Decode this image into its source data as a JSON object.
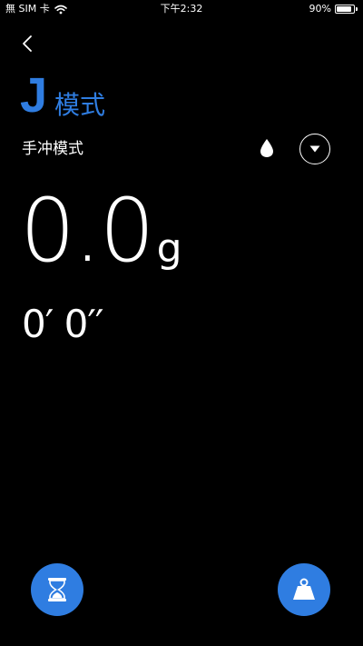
{
  "status_bar": {
    "carrier": "無 SIM 卡",
    "time": "下午2:32",
    "battery_percent_label": "90%",
    "battery_level": 0.9
  },
  "colors": {
    "background": "#000000",
    "accent": "#2f7de1",
    "text": "#ffffff"
  },
  "header": {
    "back_icon": "chevron-left-icon",
    "mode_letter": "J",
    "mode_word": "模式"
  },
  "mode": {
    "label": "手冲模式",
    "drop_icon": "water-drop-icon",
    "dropdown_icon": "caret-down-icon"
  },
  "readout": {
    "weight": "0.0",
    "unit": "g",
    "timer": "0′ 0′′"
  },
  "actions": {
    "timer_icon": "hourglass-icon",
    "tare_icon": "weight-icon"
  }
}
